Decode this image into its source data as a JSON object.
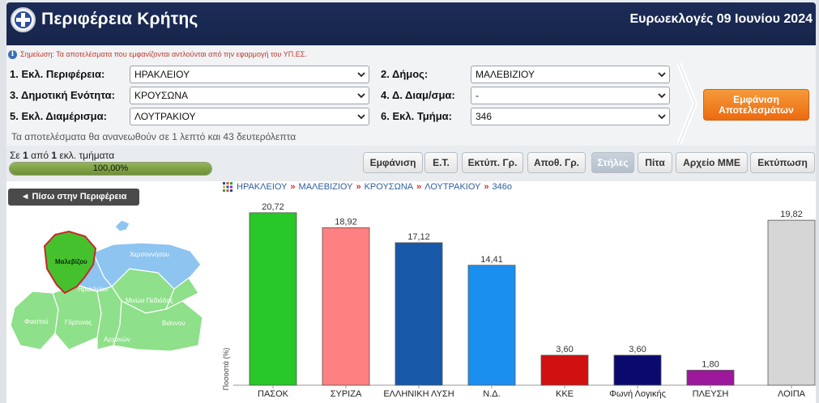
{
  "header": {
    "title": "Περιφέρεια Κρήτης",
    "election": "Ευρωεκλογές 09 Ιουνίου 2024"
  },
  "note": "Σημείωση: Τα αποτελέσματα που εμφανίζονται αντλούνται από την εφαρμογή του ΥΠ.ΕΣ.",
  "selectors": {
    "periferia": {
      "label": "1. Εκλ. Περιφέρεια:",
      "value": "ΗΡΑΚΛΕΙΟΥ"
    },
    "dimos": {
      "label": "2. Δήμος:",
      "value": "ΜΑΛΕΒΙΖΙΟΥ"
    },
    "enotita": {
      "label": "3. Δημοτική Ενότητα:",
      "value": "ΚΡΟΥΣΩΝΑ"
    },
    "diamerisma_d": {
      "label": "4. Δ. Διαμ/σμα:",
      "value": "-"
    },
    "diamerisma": {
      "label": "5. Εκλ. Διαμέρισμα:",
      "value": "ΛΟΥΤΡΑΚΙΟΥ"
    },
    "tmima": {
      "label": "6. Εκλ. Τμήμα:",
      "value": "346"
    }
  },
  "show_button": "Εμφάνιση Αποτελεσμάτων",
  "refresh_text": "Τα αποτελέσματα θα ανανεωθούν σε 1 λεπτό και 43 δευτερόλεπτα",
  "progress": {
    "prefix": "Σε",
    "counted": "1",
    "middle": "από",
    "total": "1",
    "suffix": "εκλ. τμήματα",
    "percent_text": "100,00%",
    "fraction": 1.0
  },
  "tabs": [
    {
      "label": "Εμφάνιση",
      "active": false
    },
    {
      "label": "Ε.Τ.",
      "active": false
    },
    {
      "label": "Εκτύπ. Γρ.",
      "active": false
    },
    {
      "label": "Αποθ. Γρ.",
      "active": false
    },
    {
      "label": "Στήλες",
      "active": true
    },
    {
      "label": "Πίτα",
      "active": false
    },
    {
      "label": "Αρχείο ΜΜΕ",
      "active": false
    },
    {
      "label": "Εκτύπωση",
      "active": false
    }
  ],
  "back_button": "◄ Πίσω στην Περιφέρεια",
  "breadcrumb": [
    "ΗΡΑΚΛΕΙΟΥ",
    "ΜΑΛΕΒΙΖΙΟΥ",
    "ΚΡΟΥΣΩΝΑ",
    "ΛΟΥΤΡΑΚΙΟΥ",
    "346ο"
  ],
  "map": {
    "regions": [
      "Μαλεβίζου",
      "Χερσοννήσου",
      "Ηρακλείου",
      "Μινώα Πεδιάδας",
      "Φαιστού",
      "Γόρτυνας",
      "Αρχανών",
      "Βιάννου"
    ],
    "highlight": "Μαλεβίζου",
    "colors": {
      "highlight": "#46c12e",
      "highlight_border": "#c62828",
      "light": "#8ee08a",
      "blue": "#8ec4f0"
    }
  },
  "chart_data": {
    "type": "bar",
    "ylabel": "Ποσοστά (%)",
    "categories": [
      "ΠΑΣΟΚ",
      "ΣΥΡΙΖΑ",
      "ΕΛΛΗΝΙΚΗ ΛΥΣΗ",
      "Ν.Δ.",
      "ΚΚΕ",
      "Φωνή Λογικής",
      "ΠΛΕΥΣΗ",
      "ΛΟΙΠΑ"
    ],
    "values": [
      20.72,
      18.92,
      17.12,
      14.41,
      3.6,
      3.6,
      1.8,
      19.82
    ],
    "value_labels": [
      "20,72",
      "18,92",
      "17,12",
      "14,41",
      "3,60",
      "3,60",
      "1,80",
      "19,82"
    ],
    "colors": [
      "#27c827",
      "#ff8080",
      "#1858a8",
      "#1b8ff0",
      "#d11010",
      "#0a0a6e",
      "#9c189c",
      "#d6d6d6"
    ],
    "ylim": [
      0,
      21
    ]
  }
}
